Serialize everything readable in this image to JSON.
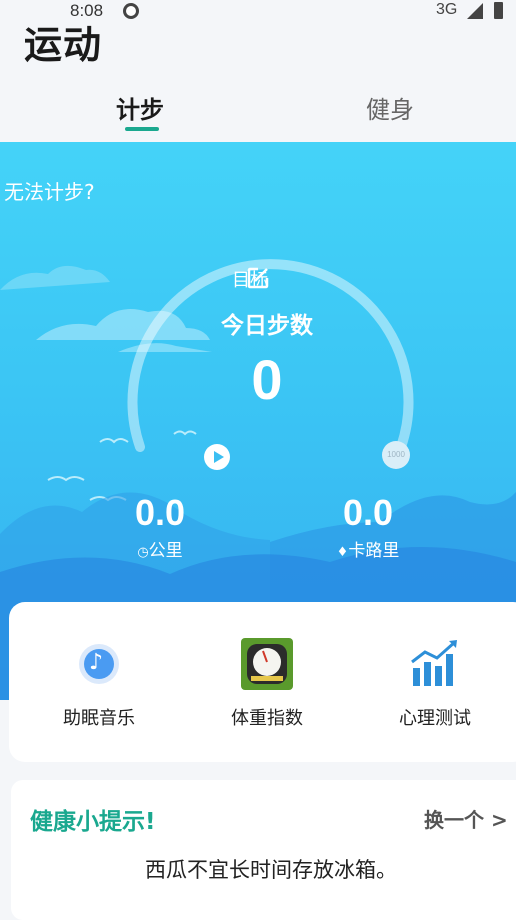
{
  "status": {
    "time": "8:08",
    "network": "3G"
  },
  "app": {
    "title": "运动"
  },
  "tabs": [
    {
      "label": "计步",
      "active": true
    },
    {
      "label": "健身",
      "active": false
    }
  ],
  "hero": {
    "cant_count": "无法计步?",
    "goal_label": "目标",
    "today_steps_label": "今日步数",
    "steps_value": "0",
    "goal_marker": "1000",
    "distance": {
      "value": "0.0",
      "label": "公里"
    },
    "calories": {
      "value": "0.0",
      "label": "卡路里"
    }
  },
  "features": [
    {
      "label": "助眠音乐",
      "icon": "music-note-icon"
    },
    {
      "label": "体重指数",
      "icon": "scale-icon"
    },
    {
      "label": "心理测试",
      "icon": "bar-chart-icon"
    }
  ],
  "tip": {
    "title": "健康小提示!",
    "more": "换一个 >",
    "text": "西瓜不宜长时间存放冰箱。"
  },
  "colors": {
    "accent": "#1aa88f",
    "hero_top": "#44d3f8",
    "hero_bottom": "#35aef0"
  }
}
